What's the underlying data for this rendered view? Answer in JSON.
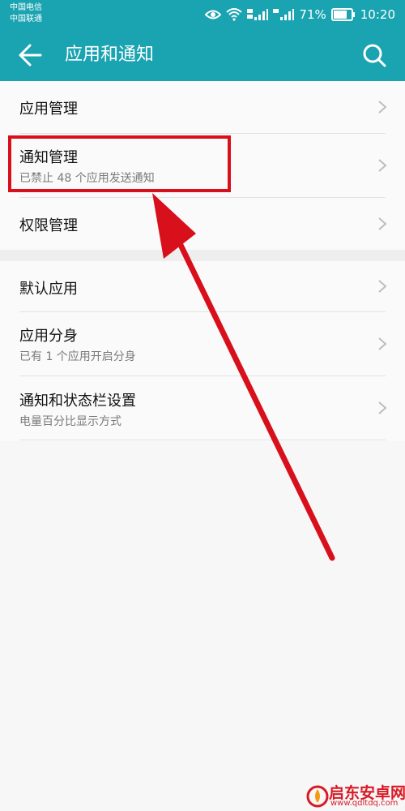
{
  "status_bar": {
    "carrier_1": "中国电信",
    "carrier_2": "中国联通",
    "battery": "71%",
    "time": "10:20",
    "icons": [
      "eye-icon",
      "wifi-icon",
      "signal-4g-icon",
      "signal-4g-icon",
      "battery-icon"
    ]
  },
  "app_bar": {
    "title": "应用和通知",
    "back_icon": "arrow-left-icon",
    "search_icon": "search-icon",
    "color": "#1aa3b0"
  },
  "settings": {
    "group1": [
      {
        "label": "应用管理",
        "subtitle": ""
      },
      {
        "label": "通知管理",
        "subtitle": "已禁止 48 个应用发送通知"
      },
      {
        "label": "权限管理",
        "subtitle": ""
      }
    ],
    "group2": [
      {
        "label": "默认应用",
        "subtitle": ""
      },
      {
        "label": "应用分身",
        "subtitle": "已有 1 个应用开启分身"
      },
      {
        "label": "通知和状态栏设置",
        "subtitle": "电量百分比显示方式"
      }
    ]
  },
  "annotation": {
    "highlight_color": "#d8101c",
    "arrow_color": "#d8101c"
  },
  "watermark": {
    "text": "启东安卓网",
    "url": "www.qdltdq.com"
  }
}
